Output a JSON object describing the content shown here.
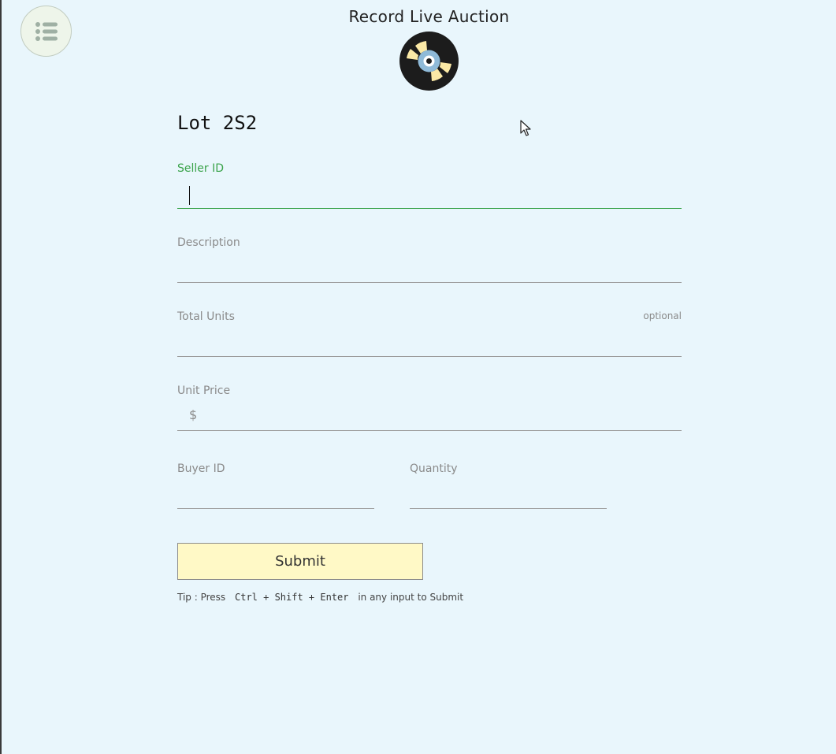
{
  "header": {
    "title": "Record Live Auction",
    "menu_icon": "list-icon",
    "logo_icon": "vinyl-record-icon"
  },
  "form": {
    "lot_title": "Lot 2S2",
    "seller_id": {
      "label": "Seller ID",
      "value": ""
    },
    "description": {
      "label": "Description",
      "value": ""
    },
    "total_units": {
      "label": "Total Units",
      "optional_text": "optional",
      "value": ""
    },
    "unit_price": {
      "label": "Unit Price",
      "prefix": "$",
      "value": ""
    },
    "buyer_id": {
      "label": "Buyer ID",
      "value": ""
    },
    "quantity": {
      "label": "Quantity",
      "value": ""
    },
    "submit_label": "Submit",
    "tip": {
      "prefix": "Tip : Press",
      "keys": "Ctrl + Shift + Enter",
      "suffix": "in any input to Submit"
    }
  },
  "colors": {
    "background": "#e9f6fc",
    "active_accent": "#2e9e3f",
    "submit_bg": "#fff9c6"
  }
}
